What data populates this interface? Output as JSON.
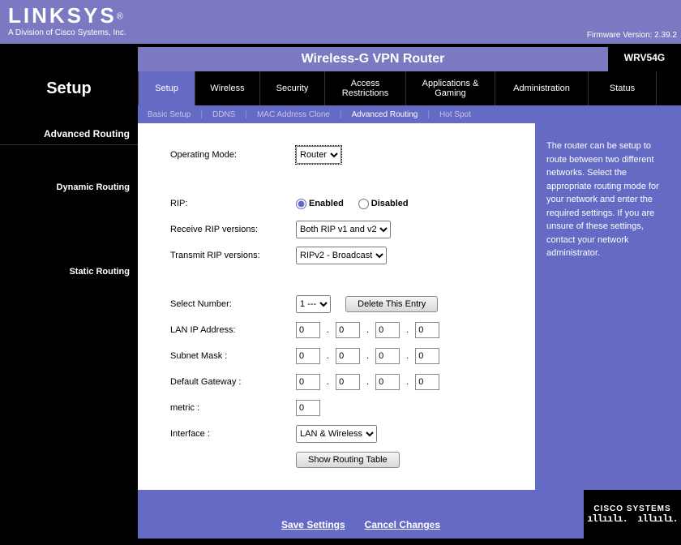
{
  "brand": {
    "name": "LINKSYS",
    "reg": "®",
    "sub": "A Division of Cisco Systems, Inc."
  },
  "firmware": "Firmware Version: 2.39.2",
  "product": "Wireless-G VPN Router",
  "model": "WRV54G",
  "page_title": "Setup",
  "tabs": [
    "Setup",
    "Wireless",
    "Security",
    "Access Restrictions",
    "Applications & Gaming",
    "Administration",
    "Status"
  ],
  "subtabs": {
    "items": [
      "Basic Setup",
      "DDNS",
      "MAC Address Clone",
      "Advanced Routing",
      "Hot Spot"
    ],
    "active": 3
  },
  "sidebar": {
    "head": "Advanced Routing",
    "dyn": "Dynamic Routing",
    "stat": "Static Routing"
  },
  "form": {
    "op_mode_lbl": "Operating Mode:",
    "op_mode_val": "Router",
    "rip_lbl": "RIP:",
    "rip_enabled": "Enabled",
    "rip_disabled": "Disabled",
    "recv_lbl": "Receive RIP versions:",
    "recv_val": "Both RIP v1 and v2",
    "xmit_lbl": "Transmit RIP versions:",
    "xmit_val": "RIPv2 - Broadcast",
    "selnum_lbl": "Select Number:",
    "selnum_val": "1 ---",
    "del_btn": "Delete This Entry",
    "lanip_lbl": "LAN IP Address:",
    "subnet_lbl": "Subnet Mask :",
    "gw_lbl": "Default Gateway :",
    "metric_lbl": "metric :",
    "metric_val": "0",
    "if_lbl": "Interface :",
    "if_val": "LAN & Wireless",
    "show_btn": "Show Routing Table",
    "ip": {
      "a": "0",
      "b": "0",
      "c": "0",
      "d": "0"
    },
    "mask": {
      "a": "0",
      "b": "0",
      "c": "0",
      "d": "0"
    },
    "gw": {
      "a": "0",
      "b": "0",
      "c": "0",
      "d": "0"
    }
  },
  "help": "The router can be setup to route between two different networks. Select the appropriate routing mode for your network and enter the required settings. If you are unsure of these settings, contact your network administrator.",
  "footer": {
    "save": "Save Settings",
    "cancel": "Cancel Changes",
    "cisco": "CISCO SYSTEMS"
  }
}
